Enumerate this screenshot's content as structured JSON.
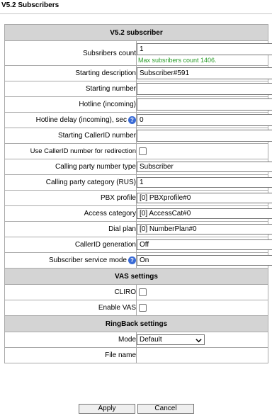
{
  "page": {
    "title": "V5.2 Subscribers"
  },
  "form": {
    "section_title": "V5.2 subscriber",
    "subscribers_count": {
      "label": "Subsribers count",
      "value": "1",
      "hint": "Max subsribers count 1406."
    },
    "starting_description": {
      "label": "Starting description",
      "value": "Subscriber#591"
    },
    "starting_number": {
      "label": "Starting number",
      "value": ""
    },
    "hotline": {
      "label": "Hotline (incoming)",
      "value": ""
    },
    "hotline_delay": {
      "label": "Hotline delay (incoming), sec",
      "value": "0",
      "help": "?"
    },
    "starting_callerid": {
      "label": "Starting CallerID number",
      "value": ""
    },
    "use_callerid_redirection": {
      "label": "Use CallerID number for redirection",
      "checked": false
    },
    "calling_party_number_type": {
      "label": "Calling party number type",
      "selected": "Subscriber"
    },
    "calling_party_category": {
      "label": "Calling party category (RUS)",
      "selected": "1"
    },
    "pbx_profile": {
      "label": "PBX profile",
      "selected": "[0] PBXprofile#0"
    },
    "access_category": {
      "label": "Access category",
      "selected": "[0] AccessCat#0"
    },
    "dial_plan": {
      "label": "Dial plan",
      "selected": "[0] NumberPlan#0"
    },
    "callerid_generation": {
      "label": "CallerID generation",
      "selected": "Off"
    },
    "subscriber_service_mode": {
      "label": "Subscriber service mode",
      "selected": "On",
      "help": "?"
    }
  },
  "vas": {
    "section_title": "VAS settings",
    "cliro": {
      "label": "CLIRO",
      "checked": false
    },
    "enable_vas": {
      "label": "Enable VAS",
      "checked": false
    }
  },
  "ringback": {
    "section_title": "RingBack settings",
    "mode": {
      "label": "Mode",
      "selected": "Default"
    },
    "file_name": {
      "label": "File name",
      "value": ""
    }
  },
  "buttons": {
    "apply": "Apply",
    "cancel": "Cancel"
  }
}
